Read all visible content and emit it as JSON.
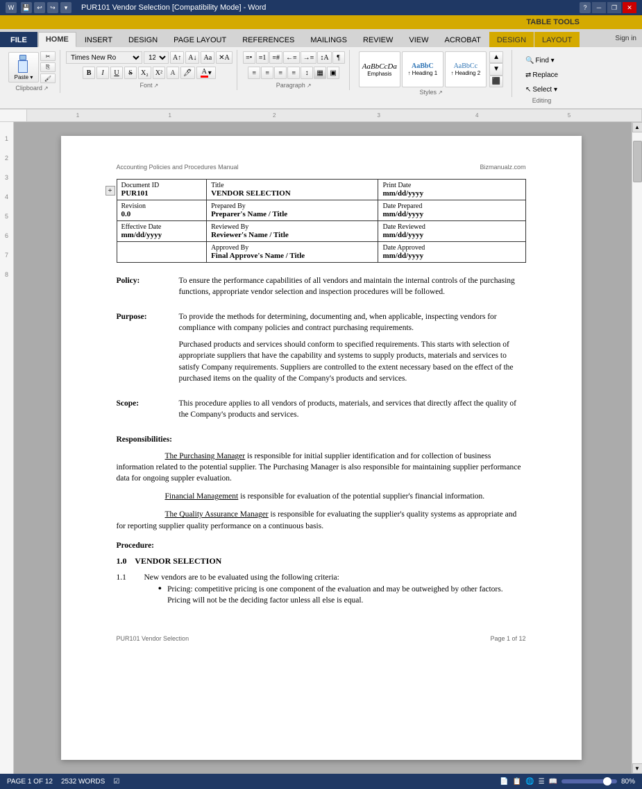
{
  "titleBar": {
    "title": "PUR101 Vendor Selection [Compatibility Mode] - Word",
    "icons": [
      "word-icon",
      "save-icon",
      "undo-icon",
      "redo-icon",
      "customize-icon"
    ],
    "windowButtons": [
      "minimize",
      "restore",
      "close"
    ],
    "tableToolsLabel": "TABLE TOOLS",
    "helpIcon": "?"
  },
  "ribbonTabs": {
    "tabs": [
      "FILE",
      "HOME",
      "INSERT",
      "DESIGN",
      "PAGE LAYOUT",
      "REFERENCES",
      "MAILINGS",
      "REVIEW",
      "VIEW",
      "ACROBAT",
      "DESIGN",
      "LAYOUT"
    ],
    "activeTab": "HOME",
    "specialTabs": [
      "DESIGN",
      "LAYOUT"
    ],
    "signIn": "Sign in"
  },
  "fontGroup": {
    "fontName": "Times New Ro",
    "fontSize": "12",
    "label": "Font",
    "expandIcon": "↗"
  },
  "paragraphGroup": {
    "label": "Paragraph",
    "expandIcon": "↗"
  },
  "stylesGroup": {
    "label": "Styles",
    "styles": [
      {
        "name": "Emphasis",
        "preview": "AaBbCcDa",
        "italic": true
      },
      {
        "name": "↑ Heading 1",
        "preview": "AaBbC",
        "bold": true
      },
      {
        "name": "↑ Heading 2",
        "preview": "AaBbCc"
      }
    ],
    "expandIcon": "↗"
  },
  "editingGroup": {
    "label": "Editing",
    "find": "Find ▾",
    "replace": "Replace",
    "select": "Select ▾"
  },
  "clipboardGroup": {
    "label": "Clipboard",
    "expandIcon": "↗"
  },
  "pageHeader": {
    "left": "Accounting Policies and Procedures Manual",
    "right": "Bizmanualz.com"
  },
  "documentTable": {
    "rows": [
      {
        "col1Label": "Document ID",
        "col1Value": "PUR101",
        "col2Label": "Title",
        "col2Value": "VENDOR SELECTION",
        "col3Label": "Print Date",
        "col3Value": "mm/dd/yyyy"
      },
      {
        "col1Label": "Revision",
        "col1Value": "0.0",
        "col2Label": "Prepared By",
        "col2Value": "Preparer's Name / Title",
        "col3Label": "Date Prepared",
        "col3Value": "mm/dd/yyyy"
      },
      {
        "col1Label": "Effective Date",
        "col1Value": "mm/dd/yyyy",
        "col2Label": "Reviewed By",
        "col2Value": "Reviewer's Name / Title",
        "col3Label": "Date Reviewed",
        "col3Value": "mm/dd/yyyy"
      },
      {
        "col1Label": "",
        "col1Value": "",
        "col2Label": "Approved By",
        "col2Value": "Final Approve's Name / Title",
        "col3Label": "Date Approved",
        "col3Value": "mm/dd/yyyy"
      }
    ]
  },
  "sections": {
    "policy": {
      "label": "Policy:",
      "text": "To ensure the performance capabilities of all vendors and maintain the internal controls of the purchasing functions, appropriate vendor selection and inspection procedures will be followed."
    },
    "purpose": {
      "label": "Purpose:",
      "para1": "To provide the methods for determining, documenting and, when applicable, inspecting vendors for compliance with company policies and contract purchasing requirements.",
      "para2": "Purchased products and services should conform to specified requirements.  This starts with selection of appropriate suppliers that have the capability and systems to supply products, materials and services to satisfy Company requirements.  Suppliers are controlled to the extent necessary based on the effect of the purchased items on the quality of the Company's products and services."
    },
    "scope": {
      "label": "Scope:",
      "text": "This procedure applies to all vendors of products, materials, and services that directly affect the quality of the Company's products and services."
    },
    "responsibilities": {
      "heading": "Responsibilities:",
      "items": [
        {
          "title": "Purchasing Manager",
          "text": " is responsible for initial supplier identification and for collection of business information related to the potential supplier. The Purchasing Manager is also responsible for maintaining supplier performance data for ongoing suppler evaluation."
        },
        {
          "title": "Financial Management",
          "text": " is responsible for evaluation of the potential supplier's financial information."
        },
        {
          "title": "Quality Assurance Manager",
          "text": " is responsible for evaluating the supplier's quality systems as appropriate and for reporting supplier quality performance on a continuous basis."
        }
      ]
    },
    "procedure": {
      "heading": "Procedure:",
      "section1": {
        "number": "1.0",
        "title": "VENDOR SELECTION",
        "subsections": [
          {
            "number": "1.1",
            "text": "New vendors are to be evaluated using the following criteria:",
            "bullets": [
              "Pricing: competitive pricing is one component of the evaluation and may be outweighed by other factors.  Pricing will not be the deciding factor unless all else is equal."
            ]
          }
        ]
      }
    }
  },
  "pageFooter": {
    "left": "PUR101 Vendor Selection",
    "right": "Page 1 of 12"
  },
  "statusBar": {
    "page": "PAGE 1 OF 12",
    "words": "2532 WORDS",
    "trackChanges": "☑",
    "zoom": "80%",
    "zoomPercent": 80
  }
}
